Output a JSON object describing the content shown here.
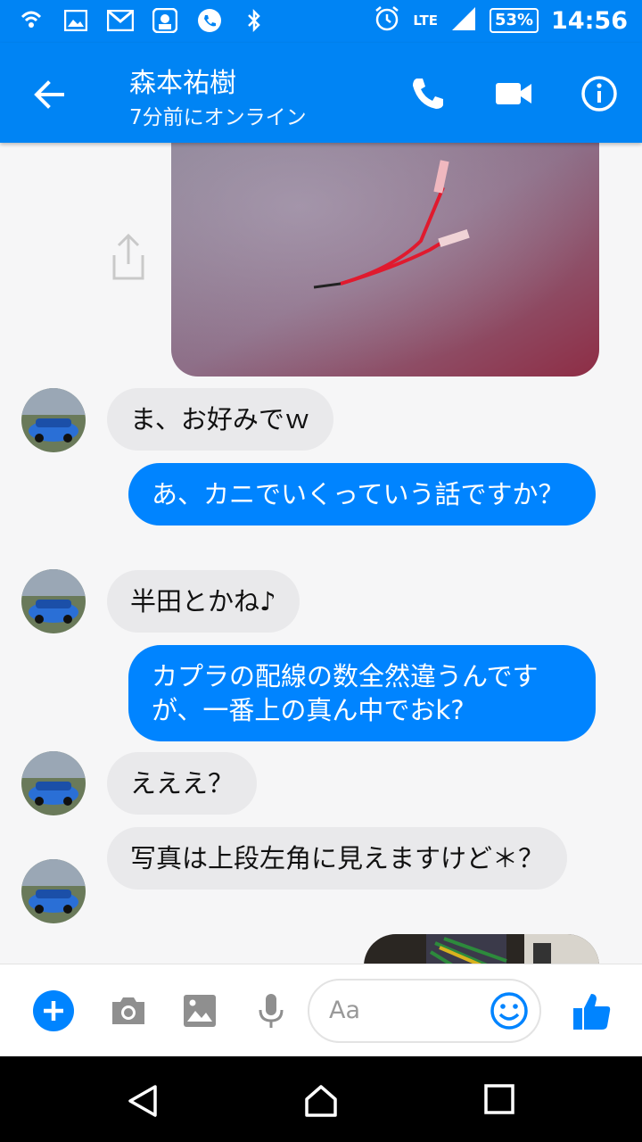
{
  "status_bar": {
    "lte": "LTE",
    "battery": "53%",
    "time": "14:56",
    "left_icons": [
      "wifi-calling-icon",
      "image-icon",
      "gmail-icon",
      "app-icon",
      "phone-icon",
      "bluetooth-icon"
    ]
  },
  "header": {
    "title": "森本祐樹",
    "subtitle": "7分前にオンライン",
    "accent_color": "#0084f4"
  },
  "messages": [
    {
      "from": "them",
      "text": "ま、お好みでｗ"
    },
    {
      "from": "me",
      "text": "あ、カニでいくっていう話ですか？"
    },
    {
      "from": "them",
      "text": "半田とかね♪"
    },
    {
      "from": "me",
      "text": "カプラの配線の数全然違うんですが、一番上の真ん中でおk?"
    },
    {
      "from": "them",
      "text": "えええ？"
    },
    {
      "from": "them",
      "text": "写真は上段左角に見えますけど＊？"
    }
  ],
  "composer": {
    "placeholder": "Aa"
  },
  "colors": {
    "outgoing_bubble": "#0084ff",
    "incoming_bubble": "#e9e9eb"
  }
}
